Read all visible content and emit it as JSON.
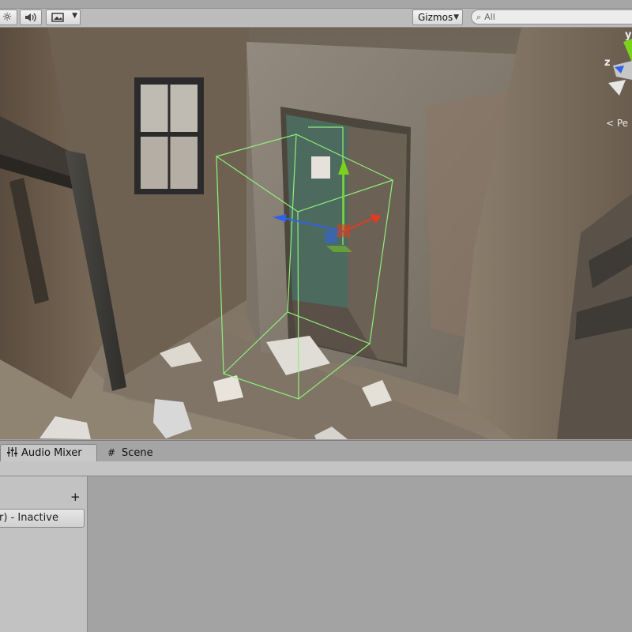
{
  "toolbar": {
    "light_icon": "sun-icon",
    "audio_icon": "speaker-icon",
    "effects_icon": "image-icon",
    "gizmos_label": "Gizmos",
    "search_placeholder": "All"
  },
  "viewport": {
    "axis_y": "y",
    "axis_z": "z",
    "projection_label": "Pe",
    "gizmo_colors": {
      "y": "#7cd11b",
      "z": "#2f62e6",
      "x": "#e8391c",
      "bounds": "#8ef07a"
    }
  },
  "tabs": [
    {
      "label": "Audio Mixer",
      "icon": "mixer-icon",
      "active": true
    },
    {
      "label": "Scene",
      "icon": "grid-icon",
      "active": false
    }
  ],
  "mixer": {
    "add_label": "+",
    "snapshot_item": "r) - Inactive"
  }
}
